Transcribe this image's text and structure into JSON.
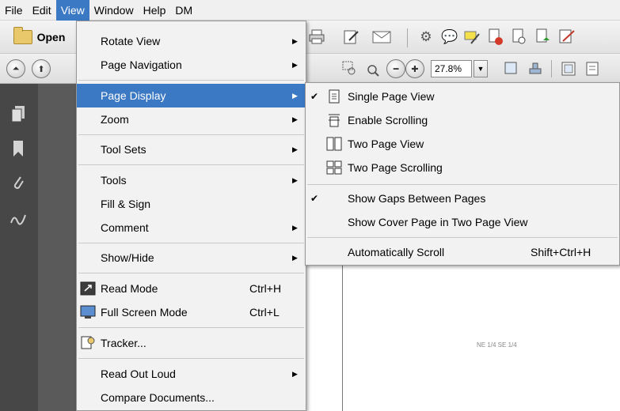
{
  "menubar": {
    "items": [
      "File",
      "Edit",
      "View",
      "Window",
      "Help",
      "DM"
    ]
  },
  "toolbar": {
    "open_label": "Open",
    "zoom_value": "27.8%"
  },
  "view_menu": {
    "items": [
      {
        "label": "Rotate View",
        "submenu": true
      },
      {
        "label": "Page Navigation",
        "submenu": true
      },
      {
        "label": "Page Display",
        "submenu": true,
        "highlighted": true
      },
      {
        "label": "Zoom",
        "submenu": true
      },
      {
        "label": "Tool Sets",
        "submenu": true
      },
      {
        "label": "Tools",
        "submenu": true
      },
      {
        "label": "Fill & Sign"
      },
      {
        "label": "Comment",
        "submenu": true
      },
      {
        "label": "Show/Hide",
        "submenu": true
      },
      {
        "label": "Read Mode",
        "shortcut": "Ctrl+H",
        "icon": "read-mode-icon"
      },
      {
        "label": "Full Screen Mode",
        "shortcut": "Ctrl+L",
        "icon": "full-screen-icon"
      },
      {
        "label": "Tracker...",
        "icon": "tracker-icon"
      },
      {
        "label": "Read Out Loud",
        "submenu": true
      },
      {
        "label": "Compare Documents..."
      }
    ]
  },
  "page_display_submenu": {
    "items": [
      {
        "label": "Single Page View",
        "checked": true,
        "icon": "single-page-icon"
      },
      {
        "label": "Enable Scrolling",
        "icon": "scrolling-icon"
      },
      {
        "label": "Two Page View",
        "icon": "two-page-icon"
      },
      {
        "label": "Two Page Scrolling",
        "icon": "two-page-scrolling-icon"
      },
      {
        "label": "Show Gaps Between Pages",
        "checked": true
      },
      {
        "label": "Show Cover Page in Two Page View"
      },
      {
        "label": "Automatically Scroll",
        "shortcut": "Shift+Ctrl+H"
      }
    ]
  },
  "document": {
    "label": "NE 1/4 SE 1/4"
  },
  "colors": {
    "highlight": "#3b79c4",
    "nav_pane": "#474747",
    "menu_bg": "#f2f2f2"
  }
}
